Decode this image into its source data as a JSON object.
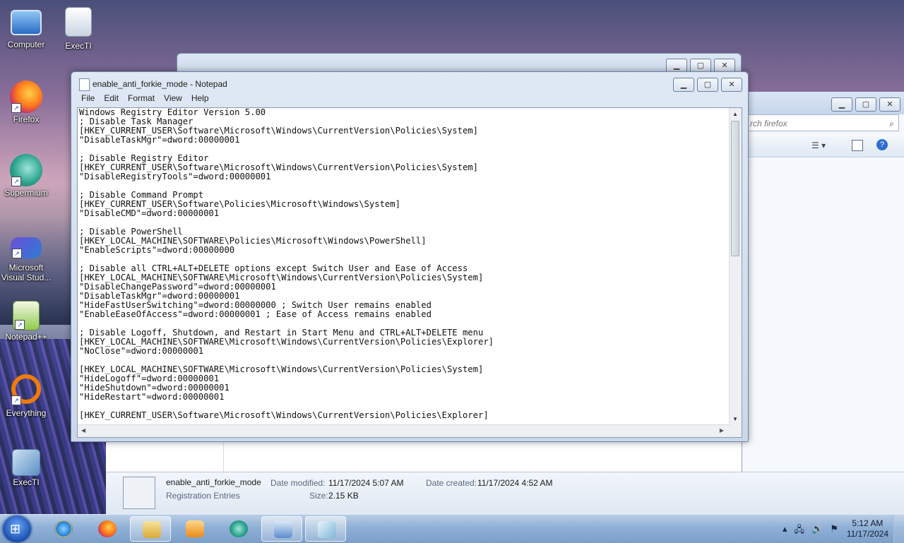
{
  "desktop": {
    "icons": [
      {
        "label": "Computer",
        "icon": "computer-icon"
      },
      {
        "label": "ExecTI",
        "icon": "gear-document-icon"
      },
      {
        "label": "Firefox",
        "icon": "firefox-icon"
      },
      {
        "label": "Supermium",
        "icon": "supermium-icon"
      },
      {
        "label": "Microsoft Visual Stud...",
        "icon": "visual-studio-icon"
      },
      {
        "label": "Notepad++",
        "icon": "notepadpp-icon"
      },
      {
        "label": "Everything",
        "icon": "everything-icon"
      },
      {
        "label": "ExecTI",
        "icon": "execti-user-icon"
      }
    ]
  },
  "explorer": {
    "search_placeholder": "Search firefox",
    "search_visible_text": "rch firefox",
    "details": {
      "file_name": "enable_anti_forkie_mode",
      "file_type": "Registration Entries",
      "date_modified_label": "Date modified:",
      "date_modified": "11/17/2024 5:07 AM",
      "date_created_label": "Date created:",
      "date_created": "11/17/2024 4:52 AM",
      "size_label": "Size:",
      "size": "2.15 KB"
    }
  },
  "notepad": {
    "title": "enable_anti_forkie_mode - Notepad",
    "menu": [
      "File",
      "Edit",
      "Format",
      "View",
      "Help"
    ],
    "content": "Windows Registry Editor Version 5.00\n; Disable Task Manager\n[HKEY_CURRENT_USER\\Software\\Microsoft\\Windows\\CurrentVersion\\Policies\\System]\n\"DisableTaskMgr\"=dword:00000001\n\n; Disable Registry Editor\n[HKEY_CURRENT_USER\\Software\\Microsoft\\Windows\\CurrentVersion\\Policies\\System]\n\"DisableRegistryTools\"=dword:00000001\n\n; Disable Command Prompt\n[HKEY_CURRENT_USER\\Software\\Policies\\Microsoft\\Windows\\System]\n\"DisableCMD\"=dword:00000001\n\n; Disable PowerShell\n[HKEY_LOCAL_MACHINE\\SOFTWARE\\Policies\\Microsoft\\Windows\\PowerShell]\n\"EnableScripts\"=dword:00000000\n\n; Disable all CTRL+ALT+DELETE options except Switch User and Ease of Access\n[HKEY_LOCAL_MACHINE\\SOFTWARE\\Microsoft\\Windows\\CurrentVersion\\Policies\\System]\n\"DisableChangePassword\"=dword:00000001\n\"DisableTaskMgr\"=dword:00000001\n\"HideFastUserSwitching\"=dword:00000000 ; Switch User remains enabled\n\"EnableEaseOfAccess\"=dword:00000001 ; Ease of Access remains enabled\n\n; Disable Logoff, Shutdown, and Restart in Start Menu and CTRL+ALT+DELETE menu\n[HKEY_LOCAL_MACHINE\\SOFTWARE\\Microsoft\\Windows\\CurrentVersion\\Policies\\Explorer]\n\"NoClose\"=dword:00000001\n\n[HKEY_LOCAL_MACHINE\\SOFTWARE\\Microsoft\\Windows\\CurrentVersion\\Policies\\System]\n\"HideLogoff\"=dword:00000001\n\"HideShutdown\"=dword:00000001\n\"HideRestart\"=dword:00000001\n\n[HKEY_CURRENT_USER\\Software\\Microsoft\\Windows\\CurrentVersion\\Policies\\Explorer]"
  },
  "taskbar": {
    "items": [
      {
        "icon": "internet-explorer-icon"
      },
      {
        "icon": "firefox-icon"
      },
      {
        "icon": "file-explorer-icon",
        "active": true
      },
      {
        "icon": "media-player-icon"
      },
      {
        "icon": "supermium-icon"
      },
      {
        "icon": "control-panel-icon",
        "active": true
      },
      {
        "icon": "notepad-icon",
        "active": true
      }
    ],
    "clock_time": "5:12 AM",
    "clock_date": "11/17/2024"
  },
  "colors": {
    "accent": "#1b4fae",
    "window_frame": "#cbd8ea"
  }
}
